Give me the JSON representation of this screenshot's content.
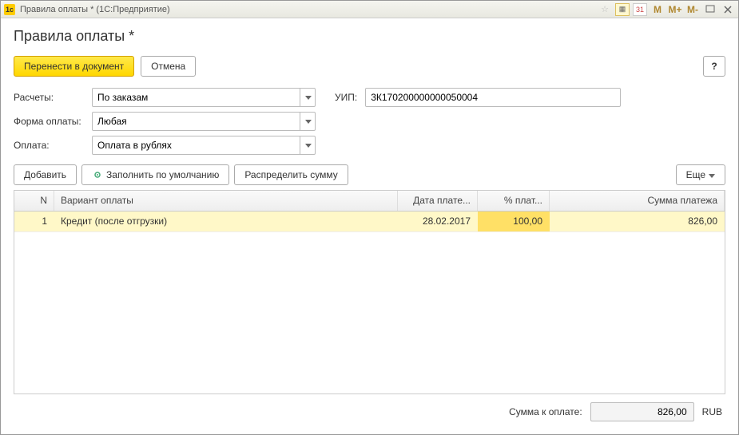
{
  "titlebar": {
    "text": "Правила оплаты * (1С:Предприятие)",
    "m_label": "M",
    "mplus_label": "M+",
    "mminus_label": "M-"
  },
  "page": {
    "title": "Правила оплаты *"
  },
  "actions": {
    "transfer": "Перенести в документ",
    "cancel": "Отмена",
    "help": "?"
  },
  "form": {
    "settlements_label": "Расчеты:",
    "settlements_value": "По заказам",
    "uip_label": "УИП:",
    "uip_value": "3К170200000000050004",
    "payment_form_label": "Форма оплаты:",
    "payment_form_value": "Любая",
    "payment_label": "Оплата:",
    "payment_value": "Оплата в рублях"
  },
  "toolbar": {
    "add": "Добавить",
    "fill_default": "Заполнить по умолчанию",
    "distribute": "Распределить сумму",
    "more": "Еще"
  },
  "table": {
    "headers": {
      "n": "N",
      "variant": "Вариант оплаты",
      "date": "Дата плате...",
      "percent": "% плат...",
      "sum": "Сумма платежа"
    },
    "rows": [
      {
        "n": "1",
        "variant": "Кредит (после отгрузки)",
        "date": "28.02.2017",
        "percent": "100,00",
        "sum": "826,00"
      }
    ]
  },
  "footer": {
    "label": "Сумма к оплате:",
    "value": "826,00",
    "currency": "RUB"
  }
}
